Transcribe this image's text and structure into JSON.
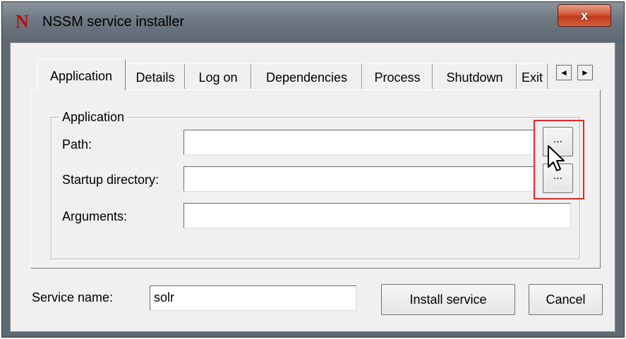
{
  "window": {
    "logo_letter": "N",
    "title": "NSSM service installer",
    "close_glyph": "x"
  },
  "tabs": [
    {
      "label": "Application",
      "selected": true
    },
    {
      "label": "Details"
    },
    {
      "label": "Log on"
    },
    {
      "label": "Dependencies"
    },
    {
      "label": "Process"
    },
    {
      "label": "Shutdown"
    },
    {
      "label": "Exit"
    }
  ],
  "tab_scroll": {
    "left_icon": "triangle-left-icon",
    "right_icon": "triangle-right-icon",
    "left_glyph": "◄",
    "right_glyph": "►"
  },
  "application_group": {
    "title": "Application",
    "path_label": "Path:",
    "path_value": "",
    "startup_label": "Startup directory:",
    "startup_value": "",
    "arguments_label": "Arguments:",
    "arguments_value": "",
    "browse_label": "..."
  },
  "footer": {
    "service_name_label": "Service name:",
    "service_name_value": "solr",
    "install_label": "Install service",
    "cancel_label": "Cancel"
  },
  "annotation": {
    "highlight_color": "#e0282c"
  },
  "colors": {
    "logo": "#b50d14",
    "close_button": "#c23a1c",
    "dialog_bg": "#f0f0f0"
  }
}
